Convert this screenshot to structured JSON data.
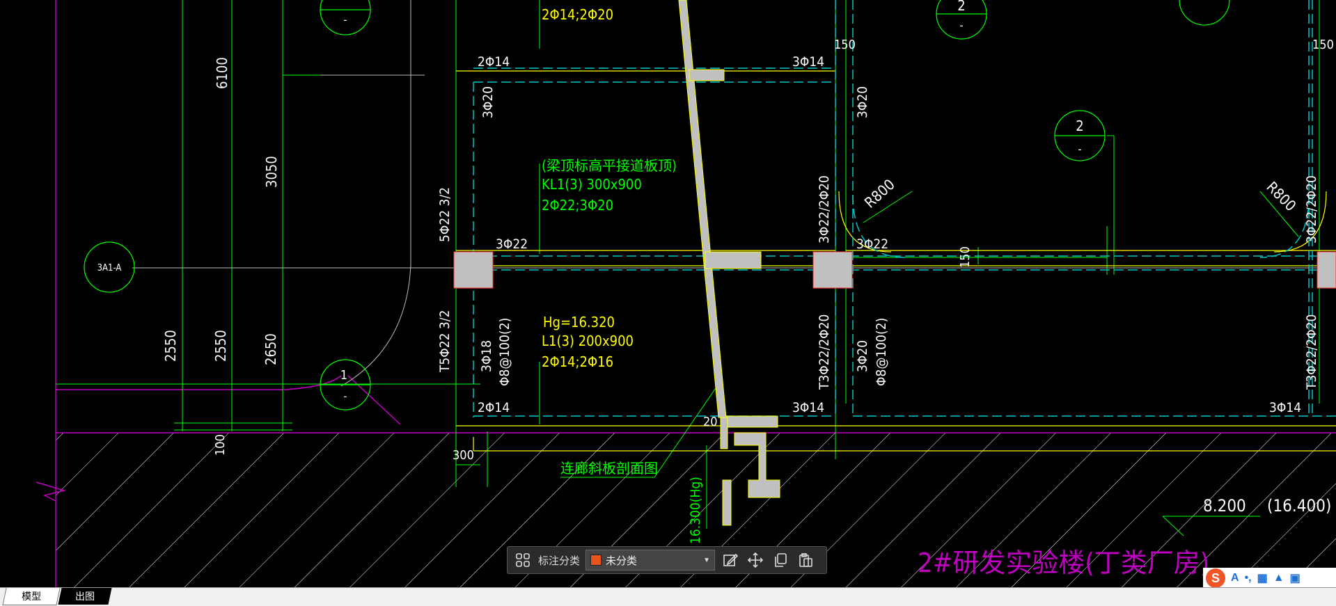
{
  "colors": {
    "background": "#000000",
    "green": "#00ff00",
    "yellow": "#ffff00",
    "cyan": "#00c8c8",
    "magenta": "#c000c0",
    "gray": "#c0c0c0",
    "accent": "#e8541c"
  },
  "drawing": {
    "labels": {
      "l01": "2Φ14;2Φ20",
      "l02": "2Φ14",
      "l03": "3Φ14",
      "l04": "3Φ20",
      "l05": "3Φ20",
      "l06": "(梁顶标高平接道板顶)",
      "l07": "KL1(3) 300x900",
      "l08": "2Φ22;3Φ20",
      "l09": "3Φ22",
      "l10": "5Φ22 3/2",
      "l11": "3Φ22/2Φ20",
      "l12": "3Φ22",
      "l13": "R800",
      "l14": "R800",
      "l15": "3Φ22/2Φ20",
      "l16": "150",
      "l17": "Hg=16.320",
      "l18": "L1(3) 200x900",
      "l19": "2Φ14;2Φ16",
      "l20": "T5Φ22 3/2",
      "l21": "3Φ18",
      "l22": "Φ8@100(2)",
      "l23": "T3Φ22/2Φ20",
      "l24": "3Φ20",
      "l25": "Φ8@100(2)",
      "l26": "T3Φ22/2Φ20",
      "l27": "2Φ14",
      "l28": "3Φ14",
      "l29": "3Φ14",
      "l30": "20",
      "l31": "连廊斜板剖面图",
      "l32": "16.300(Hg)",
      "l33": "8.200",
      "l34": "(16.400)",
      "l35": "2#研发实验楼(丁类厂房)",
      "l36": "150",
      "l37": "150",
      "l38": "300",
      "l39": "6100",
      "l40": "3050",
      "l41": "2550",
      "l42": "2550",
      "l43": "2650",
      "l44": "100",
      "c1": "3A1-A",
      "c2": "2",
      "c3": "2",
      "c4": "1",
      "c5": "-",
      "c6": "-",
      "c7": "-",
      "c8": "-"
    }
  },
  "toolbar": {
    "category_label": "标注分类",
    "category_value": "未分类",
    "icons": [
      "grid-icon",
      "edit-icon",
      "move-icon",
      "copy-icon",
      "paste-icon"
    ]
  },
  "tabs": {
    "model": "模型",
    "layout": "出图"
  },
  "ime": {
    "logo": "S",
    "items": [
      "A",
      "•,",
      "▦",
      "▲",
      "▣"
    ]
  }
}
